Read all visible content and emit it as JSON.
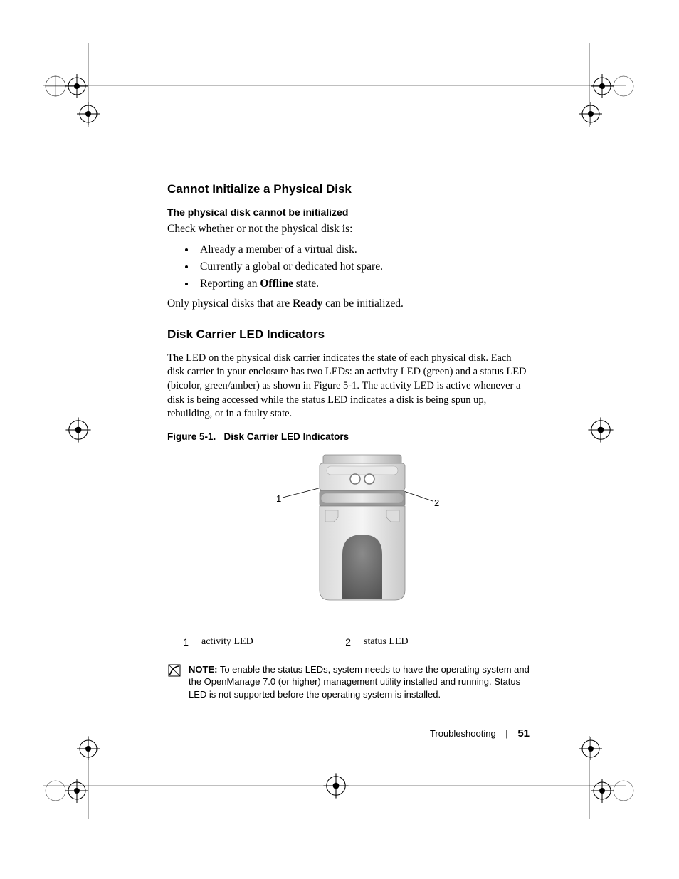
{
  "section1": {
    "heading": "Cannot Initialize a Physical Disk",
    "subheading": "The physical disk cannot be initialized",
    "intro": "Check whether or not the physical disk is:",
    "bullets": [
      "Already a member of a virtual disk.",
      "Currently a global or dedicated hot spare.",
      {
        "pre": "Reporting an ",
        "bold": "Offline",
        "post": " state."
      }
    ],
    "closing": {
      "pre": "Only physical disks that are ",
      "bold": "Ready",
      "post": " can be initialized."
    }
  },
  "section2": {
    "heading": "Disk Carrier LED Indicators",
    "para": "The LED on the physical disk carrier indicates the state of each physical disk. Each disk carrier in your enclosure has two LEDs: an activity LED (green) and a status LED (bicolor, green/amber) as shown in Figure 5-1. The activity LED is active whenever a disk is being accessed while the status LED indicates a disk is being spun up, rebuilding, or in a faulty state.",
    "fig_caption_label": "Figure 5-1.",
    "fig_caption_title": "Disk Carrier LED Indicators",
    "callouts": {
      "left": "1",
      "right": "2"
    },
    "legend": [
      {
        "num": "1",
        "label": "activity LED"
      },
      {
        "num": "2",
        "label": "status LED"
      }
    ]
  },
  "note": {
    "label": "NOTE:",
    "text": " To enable the status LEDs, system needs to have the operating system and the OpenManage 7.0 (or higher) management utility installed and running. Status LED is not supported before the operating system is installed."
  },
  "footer": {
    "section": "Troubleshooting",
    "page": "51"
  }
}
